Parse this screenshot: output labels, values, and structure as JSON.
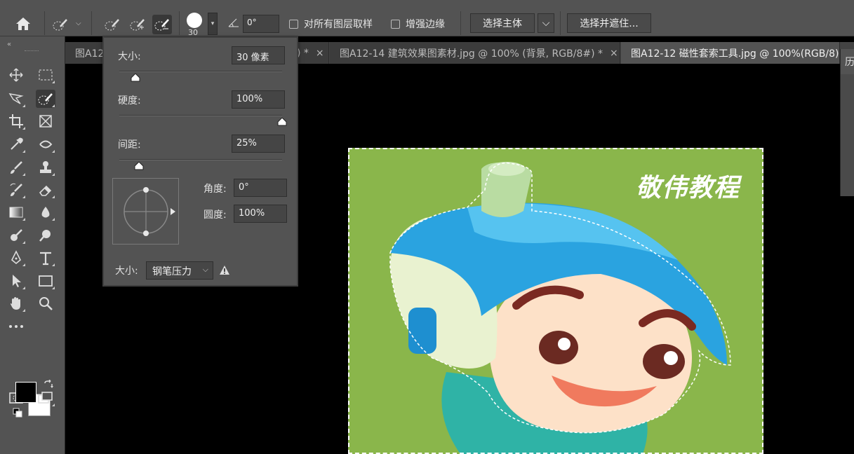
{
  "options_bar": {
    "brush_size_value": "30",
    "angle_value": "0°",
    "sample_all_layers_label": "对所有图层取样",
    "enhance_edge_label": "增强边缘",
    "select_subject_label": "选择主体",
    "select_and_mask_label": "选择并遮住..."
  },
  "tabs": [
    {
      "label": "图A12",
      "close": ""
    },
    {
      "label": ") *",
      "close": "×"
    },
    {
      "label": "图A12-14 建筑效果图素材.jpg @ 100% (背景, RGB/8#) *",
      "close": "×"
    },
    {
      "label": "图A12-12 磁性套索工具.jpg @ 100%(RGB/8)",
      "close": ""
    }
  ],
  "brush_panel": {
    "size_label": "大小:",
    "size_value": "30 像素",
    "size_level": 0.1,
    "hardness_label": "硬度:",
    "hardness_value": "100%",
    "hardness_level": 1.0,
    "spacing_label": "间距:",
    "spacing_value": "25%",
    "spacing_level": 0.12,
    "angle_label": "角度:",
    "angle_value": "0°",
    "roundness_label": "圆度:",
    "roundness_value": "100%",
    "pressure_size_label": "大小:",
    "pressure_select_value": "钢笔压力"
  },
  "canvas": {
    "watermark": "敬伟教程",
    "image_bg_color": "#8ab64b"
  },
  "right_panel": {
    "header_char": "历"
  },
  "colors": {
    "ui_bg": "#535353",
    "canvas_bg": "#000000",
    "foreground": "#000000",
    "background": "#ffffff"
  }
}
